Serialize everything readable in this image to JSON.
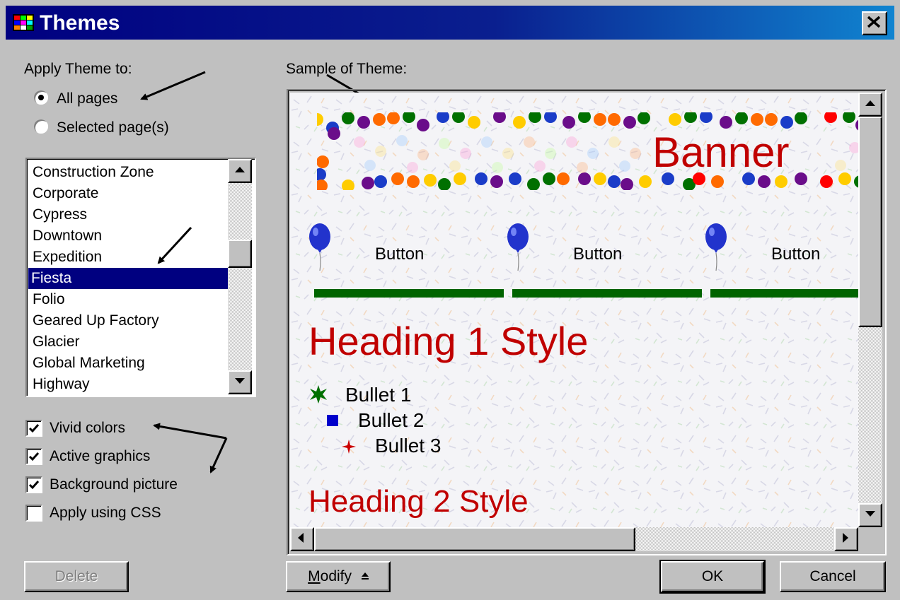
{
  "window": {
    "title": "Themes"
  },
  "apply_to": {
    "label": "Apply Theme to:",
    "options": [
      {
        "label": "All pages",
        "selected": true
      },
      {
        "label": "Selected page(s)",
        "selected": false
      }
    ]
  },
  "themes_list": {
    "items": [
      "Construction Zone",
      "Corporate",
      "Cypress",
      "Downtown",
      "Expedition",
      "Fiesta",
      "Folio",
      "Geared Up Factory",
      "Glacier",
      "Global Marketing",
      "Highway"
    ],
    "selected": "Fiesta"
  },
  "options": {
    "vivid_colors": {
      "label": "Vivid colors",
      "checked": true
    },
    "active_graphics": {
      "label": "Active graphics",
      "checked": true
    },
    "background_picture": {
      "label": "Background picture",
      "checked": true
    },
    "apply_css": {
      "label": "Apply using CSS",
      "checked": false
    }
  },
  "sample": {
    "label": "Sample of Theme:",
    "banner": "Banner",
    "nav_buttons": [
      "Button",
      "Button",
      "Button"
    ],
    "heading1": "Heading 1 Style",
    "bullets": [
      "Bullet 1",
      "Bullet 2",
      "Bullet 3"
    ],
    "heading2": "Heading 2 Style"
  },
  "buttons": {
    "delete": "Delete",
    "modify": "Modify",
    "modify_mnemonic": "M",
    "modify_rest": "odify",
    "ok": "OK",
    "cancel": "Cancel"
  },
  "colors": {
    "title_start": "#000080",
    "title_end": "#1084d0",
    "selection": "#000080",
    "theme_red": "#c00000",
    "theme_green": "#006400"
  }
}
